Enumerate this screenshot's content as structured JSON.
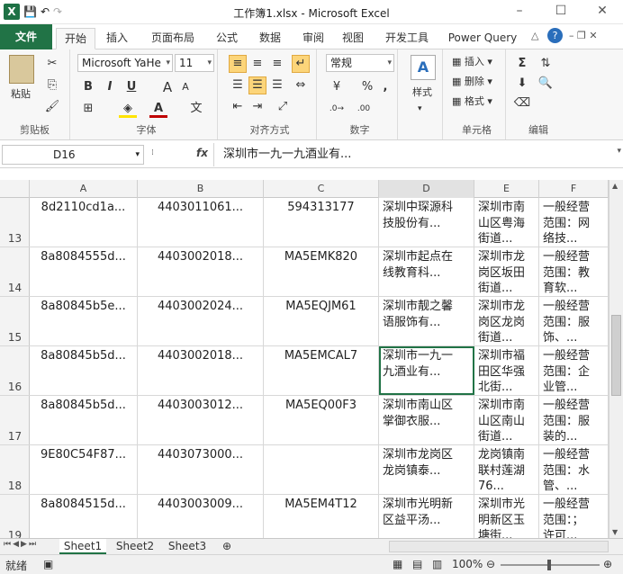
{
  "window": {
    "title": "工作簿1.xlsx  -  Microsoft Excel"
  },
  "qat": {
    "logo": "X",
    "save": "💾",
    "undo": "↶",
    "redo": "↷"
  },
  "tabs": [
    "文件",
    "开始",
    "插入",
    "页面布局",
    "公式",
    "数据",
    "审阅",
    "视图",
    "开发工具",
    "Power Query"
  ],
  "ribbon": {
    "clipboard": {
      "paste": "粘贴",
      "label": "剪贴板"
    },
    "font": {
      "name": "Microsoft YaHe",
      "size": "11",
      "label": "字体",
      "bold": "B",
      "italic": "I",
      "underline": "U",
      "grow": "A",
      "shrink": "A",
      "wen": "文"
    },
    "align": {
      "label": "对齐方式"
    },
    "number": {
      "format": "常规",
      "label": "数字",
      "percent": "%",
      "comma": ","
    },
    "styles": {
      "label": "样式",
      "icon": "A"
    },
    "cells": {
      "insert": "插入",
      "delete": "删除",
      "format": "格式",
      "label": "单元格"
    },
    "edit": {
      "label": "编辑"
    }
  },
  "formula": {
    "namebox": "D16",
    "fx": "fx",
    "content": "深圳市一九一九酒业有..."
  },
  "columns": [
    "A",
    "B",
    "C",
    "D",
    "E",
    "F"
  ],
  "rows": [
    {
      "num": "13",
      "a": "8d2110cd1a...",
      "b": "4403011061...",
      "c": "594313177",
      "d": "深圳中琛源科\n技股份有...",
      "e": "深圳市南\n山区粤海\n街道...",
      "f": "一般经营\n范围：网\n络技..."
    },
    {
      "num": "14",
      "a": "8a8084555d...",
      "b": "4403002018...",
      "c": "MA5EMK820",
      "d": "深圳市起点在\n线教育科...",
      "e": "深圳市龙\n岗区坂田\n街道...",
      "f": "一般经营\n范围：教\n育软..."
    },
    {
      "num": "15",
      "a": "8a80845b5e...",
      "b": "4403002024...",
      "c": "MA5EQJM61",
      "d": "深圳市靓之馨\n语服饰有...",
      "e": "深圳市龙\n岗区龙岗\n街道...",
      "f": "一般经营\n范围：服\n饰、..."
    },
    {
      "num": "16",
      "a": "8a80845b5d...",
      "b": "4403002018...",
      "c": "MA5EMCAL7",
      "d": "深圳市一九一\n九酒业有...",
      "e": "深圳市福\n田区华强\n北街...",
      "f": "一般经营\n范围：企\n业管..."
    },
    {
      "num": "17",
      "a": "8a80845b5d...",
      "b": "4403003012...",
      "c": "MA5EQ00F3",
      "d": "深圳市南山区\n掌御衣服...",
      "e": "深圳市南\n山区南山\n街道...",
      "f": "一般经营\n范围：服\n装的..."
    },
    {
      "num": "18",
      "a": "9E80C54F87...",
      "b": "4403073000...",
      "c": "",
      "d": "深圳市龙岗区\n龙岗镇泰...",
      "e": "龙岗镇南\n联村莲湖\n76...",
      "f": "一般经营\n范围：水\n管、..."
    },
    {
      "num": "19",
      "a": "8a8084515d...",
      "b": "4403003009...",
      "c": "MA5EM4T12",
      "d": "深圳市光明新\n区益平汤...",
      "e": "深圳市光\n明新区玉\n塘街...",
      "f": "一般经营\n范围：；\n许可..."
    }
  ],
  "sheets": [
    "Sheet1",
    "Sheet2",
    "Sheet3"
  ],
  "status": {
    "ready": "就绪",
    "zoom": "100%"
  }
}
